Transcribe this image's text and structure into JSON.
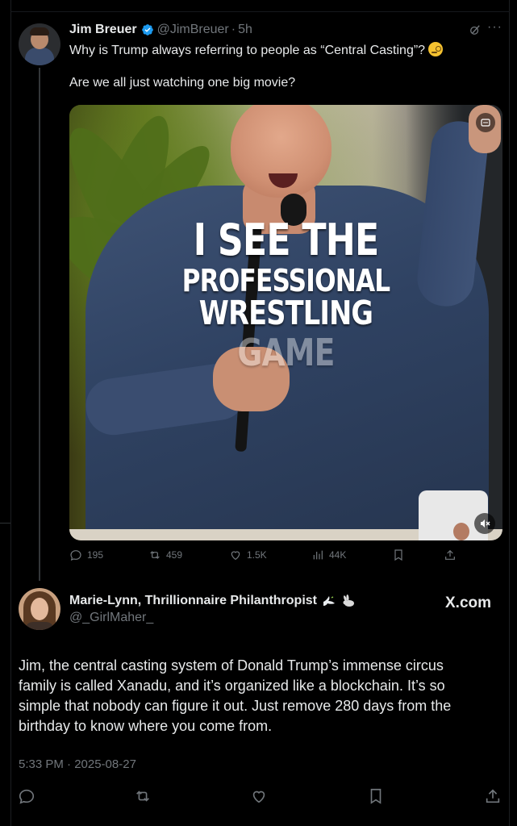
{
  "quoted_tweet": {
    "author_name": "Jim Breuer",
    "handle": "@JimBreuer",
    "time": "5h",
    "text_line1": "Why is Trump always referring to people as “Central Casting”?",
    "text_line2": "Are we all just watching one big movie?",
    "media_overlay": {
      "line1": "I SEE THE",
      "line2": "PROFESSIONAL",
      "line3": "WRESTLING",
      "line4": "GAME"
    },
    "stats": {
      "replies": "195",
      "reposts": "459",
      "likes": "1.5K",
      "views": "44K"
    }
  },
  "main_tweet": {
    "author_name": "Marie-Lynn, Thrillionnaire Philanthropist",
    "handle": "@_GirlMaher_",
    "brand": "X.com",
    "text_lines": [
      "Jim, the central casting system of Donald Trump’s immense circus",
      "family is called Xanadu, and it’s organized like a blockchain. It’s so",
      "simple that nobody can figure it out. Just remove 280 days from the",
      "birthday to know where you come from."
    ],
    "timestamp": "5:33 PM · 2025-08-27"
  },
  "colors": {
    "background": "#000000",
    "text": "#e7e9ea",
    "muted": "#71767b",
    "verified_blue": "#1d9bf0"
  }
}
